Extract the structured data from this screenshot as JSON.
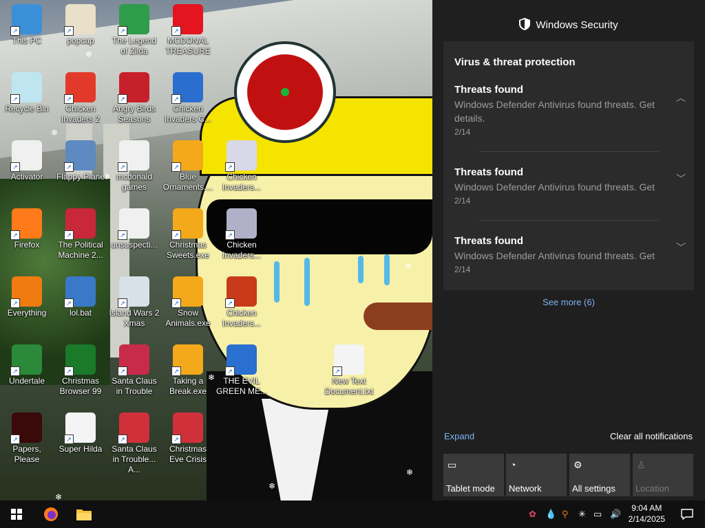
{
  "desktop_icons": [
    {
      "label": "This PC",
      "color": "#3a8fd8"
    },
    {
      "label": "popcap",
      "color": "#e8e0c8"
    },
    {
      "label": "The Legend of Zilda",
      "color": "#2e9c4a"
    },
    {
      "label": "MCDONAL TREASURE",
      "color": "#e4151f"
    },
    {
      "label": "Recycle Bin",
      "color": "#bfe6f0"
    },
    {
      "label": "Chicken Invaders 2",
      "color": "#e23a2a"
    },
    {
      "label": "Angry Birds Seasons",
      "color": "#c6202a"
    },
    {
      "label": "Chicken Invaders C...",
      "color": "#2a6fd0"
    },
    {
      "label": "Activator",
      "color": "#f0f0f0"
    },
    {
      "label": "Flappy Plane",
      "color": "#5d8ac0"
    },
    {
      "label": "mcdonald games",
      "color": "#f0f0f0"
    },
    {
      "label": "Blue Ornaments....",
      "color": "#f4a91a"
    },
    {
      "label": "Chicken Invaders...",
      "color": "#d8d8e8"
    },
    {
      "label": "Firefox",
      "color": "#ff7a1a"
    },
    {
      "label": "The Political Machine 2...",
      "color": "#c8283a"
    },
    {
      "label": "unsuspecti...",
      "color": "#f0f0f0"
    },
    {
      "label": "Christmas Sweets.exe",
      "color": "#f4a91a"
    },
    {
      "label": "Chicken Invaders...",
      "color": "#b0b0c8"
    },
    {
      "label": "Everything",
      "color": "#f07b10"
    },
    {
      "label": "lol.bat",
      "color": "#3a78c8"
    },
    {
      "label": "Island Wars 2 Xmas",
      "color": "#d8e0e8"
    },
    {
      "label": "Snow Animals.exe",
      "color": "#f4a91a"
    },
    {
      "label": "Chicken Invaders...",
      "color": "#c83a1a"
    },
    {
      "label": "Undertale",
      "color": "#2a8a3a"
    },
    {
      "label": "Christmas Browser 99",
      "color": "#1a7a2a"
    },
    {
      "label": "Santa Claus in Trouble",
      "color": "#c82a4a"
    },
    {
      "label": "Taking a Break.exe",
      "color": "#f4a91a"
    },
    {
      "label": "THE EVIL GREEN ME...",
      "color": "#2a70d0"
    },
    {
      "label": "New Text Document.txt",
      "color": "#f4f4f4"
    },
    {
      "label": "Papers, Please",
      "color": "#3a0a0a"
    },
    {
      "label": "Super Hilda",
      "color": "#f4f4f4"
    },
    {
      "label": "Santa Claus in Trouble... A...",
      "color": "#d0303a"
    },
    {
      "label": "Christmas Eve Crisis",
      "color": "#d0303a"
    }
  ],
  "action_center": {
    "app_header": "Windows Security",
    "group_title": "Virus & threat protection",
    "notifications": [
      {
        "title": "Threats found",
        "body": "Windows Defender Antivirus found threats. Get details.",
        "date": "2/14",
        "expanded": true
      },
      {
        "title": "Threats found",
        "body": "Windows Defender Antivirus found threats. Get",
        "date": "2/14",
        "expanded": false
      },
      {
        "title": "Threats found",
        "body": "Windows Defender Antivirus found threats. Get",
        "date": "2/14",
        "expanded": false
      }
    ],
    "see_more": "See more (6)",
    "expand": "Expand",
    "clear_all": "Clear all notifications",
    "quick_actions": [
      {
        "label": "Tablet mode",
        "icon": "tablet-mode-icon",
        "enabled": true
      },
      {
        "label": "Network",
        "icon": "network-icon",
        "enabled": true
      },
      {
        "label": "All settings",
        "icon": "gear-icon",
        "enabled": true
      },
      {
        "label": "Location",
        "icon": "location-icon",
        "enabled": false
      }
    ]
  },
  "taskbar": {
    "time": "9:04 AM",
    "date": "2/14/2025"
  },
  "colors": {
    "accent": "#7ab4f5",
    "panel": "#1f1f1f",
    "card": "#2b2b2b"
  }
}
